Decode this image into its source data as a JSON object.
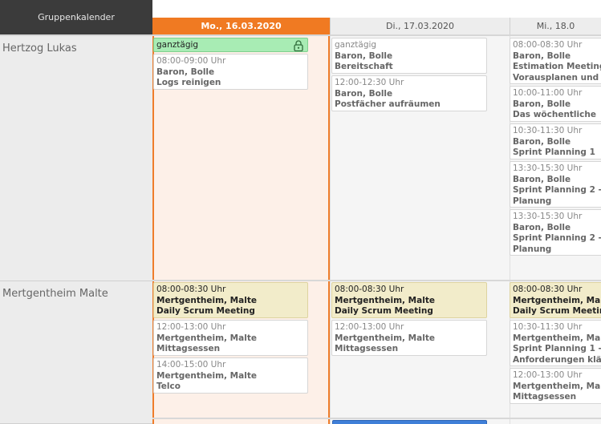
{
  "header": {
    "title": "Gruppenkalender",
    "days": [
      "Mo., 16.03.2020",
      "Di., 17.03.2020",
      "Mi., 18.0"
    ]
  },
  "people": [
    {
      "name": "Hertzog Lukas",
      "days": [
        [
          {
            "time": "ganztägig",
            "style": "green",
            "locked": true,
            "lines": []
          },
          {
            "time": "08:00-09:00 Uhr",
            "lines": [
              "Baron, Bolle",
              "Logs reinigen"
            ]
          }
        ],
        [
          {
            "time": "ganztägig",
            "lines": [
              "Baron, Bolle",
              "Bereitschaft"
            ]
          },
          {
            "time": "12:00-12:30 Uhr",
            "lines": [
              "Baron, Bolle",
              "Postfächer aufräumen"
            ]
          }
        ],
        [
          {
            "time": "08:00-08:30 Uhr",
            "lines": [
              "Baron, Bolle",
              "Estimation Meeting",
              "Vorausplanen und"
            ]
          },
          {
            "time": "10:00-11:00 Uhr",
            "lines": [
              "Baron, Bolle",
              "Das wöchentliche"
            ]
          },
          {
            "time": "10:30-11:30 Uhr",
            "lines": [
              "Baron, Bolle",
              "Sprint Planning 1"
            ]
          },
          {
            "time": "13:30-15:30 Uhr",
            "lines": [
              "Baron, Bolle",
              "Sprint Planning 2 -",
              "Planung"
            ]
          },
          {
            "time": "13:30-15:30 Uhr",
            "lines": [
              "Baron, Bolle",
              "Sprint Planning 2 -",
              "Planung"
            ]
          }
        ]
      ]
    },
    {
      "name": "Mertgentheim Malte",
      "days": [
        [
          {
            "time": "08:00-08:30 Uhr",
            "style": "yellow",
            "lines": [
              "Mertgentheim, Malte",
              "Daily Scrum Meeting"
            ]
          },
          {
            "time": "12:00-13:00 Uhr",
            "lines": [
              "Mertgentheim, Malte",
              "Mittagsessen"
            ]
          },
          {
            "time": "14:00-15:00 Uhr",
            "lines": [
              "Mertgentheim, Malte",
              "Telco"
            ]
          }
        ],
        [
          {
            "time": "08:00-08:30 Uhr",
            "style": "yellow",
            "lines": [
              "Mertgentheim, Malte",
              "Daily Scrum Meeting"
            ]
          },
          {
            "time": "12:00-13:00 Uhr",
            "lines": [
              "Mertgentheim, Malte",
              "Mittagsessen"
            ]
          }
        ],
        [
          {
            "time": "08:00-08:30 Uhr",
            "style": "yellow",
            "lines": [
              "Mertgentheim, Mal",
              "Daily Scrum Meetin"
            ]
          },
          {
            "time": "10:30-11:30 Uhr",
            "lines": [
              "Mertgentheim, Mal",
              "Sprint Planning 1 -",
              "Anforderungen klä"
            ]
          },
          {
            "time": "12:00-13:00 Uhr",
            "lines": [
              "Mertgentheim, Mal",
              "Mittagsessen"
            ]
          }
        ]
      ]
    }
  ],
  "colors": {
    "today_accent": "#f07a22",
    "allday_green": "#a8ecb4",
    "daily_yellow": "#f2ecca",
    "selected_blue": "#3f7fd8"
  }
}
